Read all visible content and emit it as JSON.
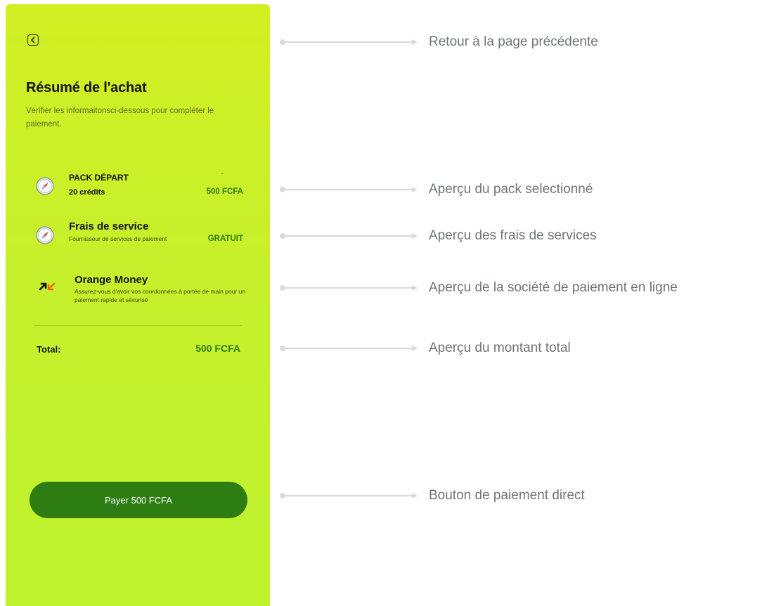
{
  "panel": {
    "back_icon": "chevron-left-icon",
    "title": "Résumé de l'achat",
    "subtitle": "Vérifier les informaitonsci-dessous pour compléter le paiement."
  },
  "items": {
    "pack": {
      "icon": "compass-icon",
      "name": "PACK DÉPART",
      "sub": "20 crédits",
      "dash": "-",
      "amount": "500 FCFA"
    },
    "fees": {
      "icon": "compass-icon",
      "name": "Frais de service",
      "sub": "Fournisseur de services de paiement",
      "amount": "GRATUIT"
    },
    "orange": {
      "icon": "orange-money-logo-icon",
      "name": "Orange Money",
      "sub": "Assurez-vous d'avoir vos coordonnées à portée de main pour un paiement rapide et sécurisé"
    }
  },
  "total": {
    "label": "Total:",
    "value": "500 FCFA"
  },
  "pay_button": {
    "label": "Payer 500 FCFA"
  },
  "annotations": [
    "Retour à la page précédente",
    "Aperçu du pack selectionné",
    "Aperçu des frais de services",
    "Aperçu de la société de paiement en ligne",
    "Aperçu du montant total",
    "Bouton de paiement direct"
  ],
  "colors": {
    "panel_top": "#d2ef22",
    "panel_bottom": "#bff32e",
    "accent_green": "#2e7d12",
    "annotation_text": "#6f7478"
  }
}
